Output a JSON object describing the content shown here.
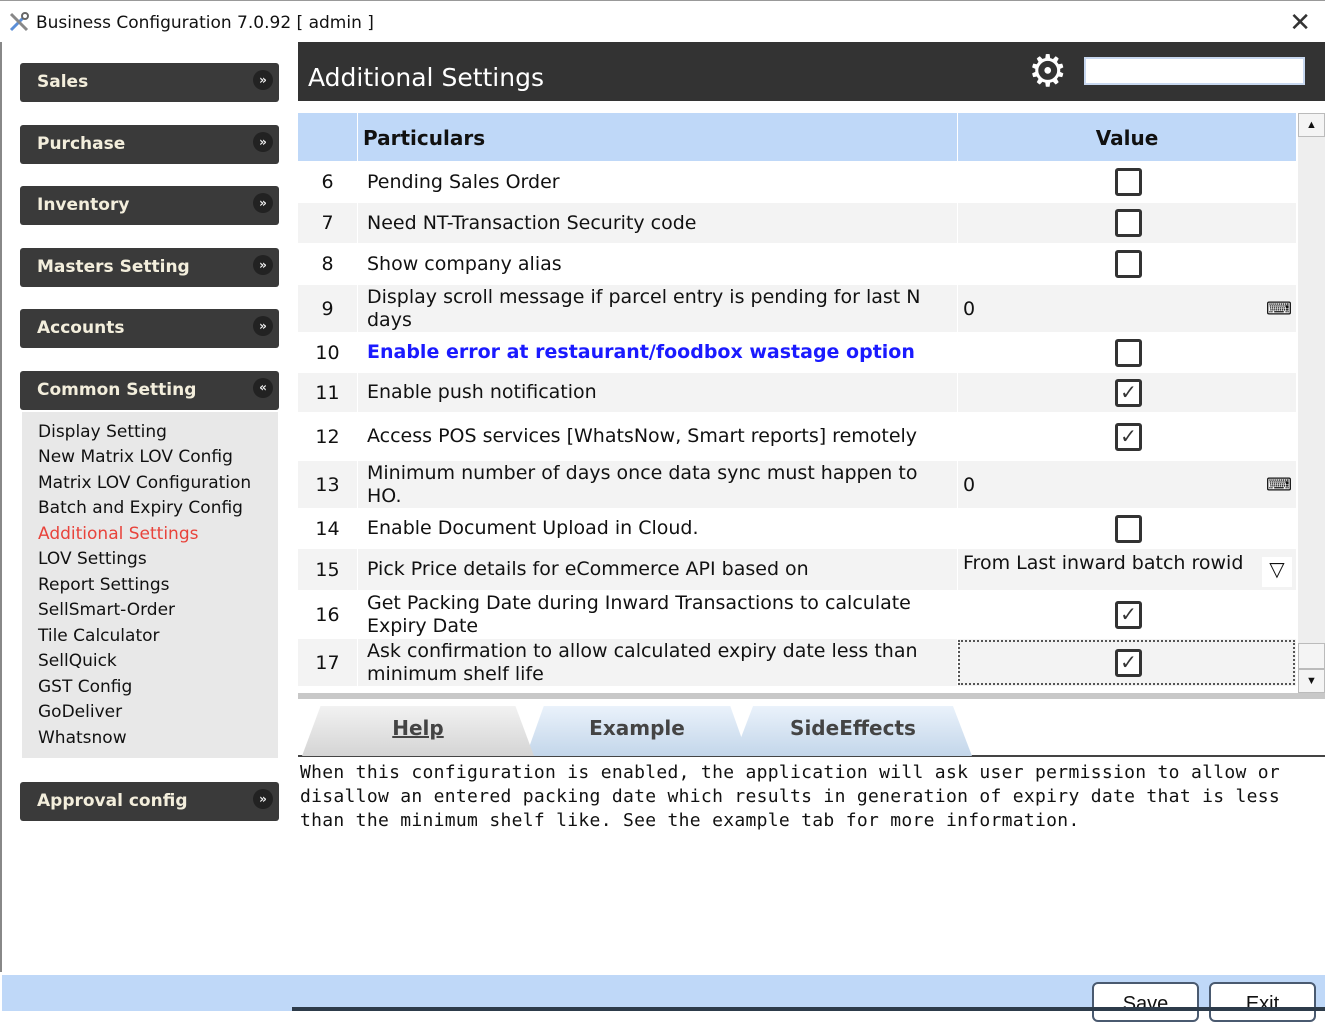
{
  "window": {
    "title": "Business Configuration 7.0.92 [ admin ]",
    "close": "✕"
  },
  "sidebar": {
    "sections": [
      {
        "label": "Sales"
      },
      {
        "label": "Purchase"
      },
      {
        "label": "Inventory"
      },
      {
        "label": "Masters Setting"
      },
      {
        "label": "Accounts"
      },
      {
        "label": "Common Setting"
      }
    ],
    "submenu": [
      "Display Setting",
      "New Matrix LOV Config",
      "Matrix LOV Configuration",
      "Batch and Expiry Config",
      "Additional Settings",
      "LOV Settings",
      "Report Settings",
      "SellSmart-Order",
      "Tile Calculator",
      "SellQuick",
      "GST Config",
      "GoDeliver",
      "Whatsnow"
    ],
    "active": "Additional Settings",
    "bottom": {
      "label": "Approval config"
    }
  },
  "main": {
    "title": "Additional Settings",
    "search_value": "",
    "col_particulars": "Particulars",
    "col_value": "Value"
  },
  "rows": [
    {
      "n": "6",
      "label": "Pending Sales Order",
      "type": "checkbox",
      "checked": false
    },
    {
      "n": "7",
      "label": "Need NT-Transaction Security code",
      "type": "checkbox",
      "checked": false
    },
    {
      "n": "8",
      "label": "Show company alias",
      "type": "checkbox",
      "checked": false
    },
    {
      "n": "9",
      "label": "Display scroll message if parcel entry is pending for last N days",
      "type": "number",
      "value": "0"
    },
    {
      "n": "10",
      "label": "Enable error at restaurant/foodbox wastage option",
      "type": "checkbox",
      "checked": false
    },
    {
      "n": "11",
      "label": "Enable push notification",
      "type": "checkbox",
      "checked": true
    },
    {
      "n": "12",
      "label": "Access POS services [WhatsNow, Smart reports] remotely",
      "type": "checkbox",
      "checked": true
    },
    {
      "n": "13",
      "label": "Minimum number of days once data sync must happen to HO.",
      "type": "number",
      "value": "0"
    },
    {
      "n": "14",
      "label": "Enable Document Upload in Cloud.",
      "type": "checkbox",
      "checked": false
    },
    {
      "n": "15",
      "label": "Pick Price details for eCommerce API based on",
      "type": "select",
      "value": "From Last inward batch rowid"
    },
    {
      "n": "16",
      "label": "Get Packing Date during Inward Transactions to calculate Expiry Date",
      "type": "checkbox",
      "checked": true
    },
    {
      "n": "17",
      "label": "Ask confirmation to allow calculated expiry date less than minimum shelf life",
      "type": "checkbox",
      "checked": true
    }
  ],
  "tabs": {
    "help": "Help",
    "example": "Example",
    "side_effects": "SideEffects"
  },
  "help_text": "When this configuration is enabled, the application will ask user permission to allow or disallow an entered packing date which results in generation of expiry date that is less than the minimum shelf like. See the example tab for more information.",
  "footer": {
    "save": "Save",
    "exit": "Exit"
  },
  "colors": {
    "header": "#333333",
    "grid_header": "#bfd8f8",
    "active_item": "#e8433b",
    "link": "#1a1aff"
  }
}
